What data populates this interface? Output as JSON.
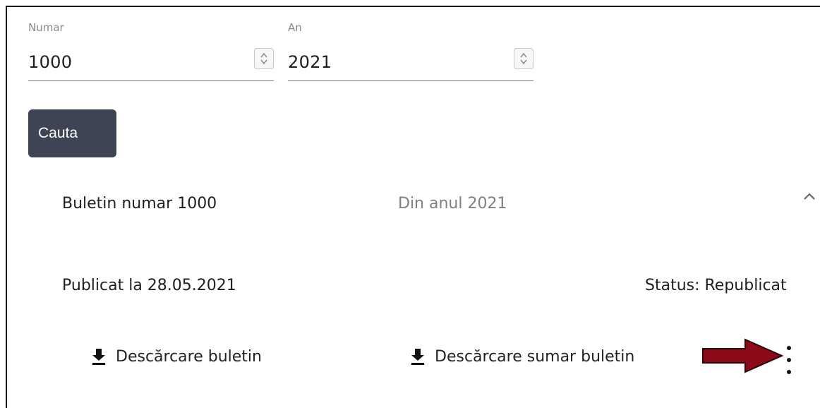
{
  "form": {
    "numar": {
      "label": "Numar",
      "value": "1000"
    },
    "an": {
      "label": "An",
      "value": "2021"
    },
    "search_label": "Cauta"
  },
  "result": {
    "title": "Buletin numar 1000",
    "year_text": "Din anul 2021",
    "published": "Publicat la 28.05.2021",
    "status": "Status: Republicat",
    "download_label": "Descărcare buletin",
    "download_summary_label": "Descărcare sumar buletin"
  },
  "icons": {
    "spinner": "up-down-chevron-icon",
    "collapse": "chevron-up-icon",
    "download": "download-icon",
    "more": "more-vert-icon",
    "annotation": "red-arrow-icon"
  },
  "colors": {
    "button_bg": "#3e4453",
    "annotation_arrow": "#8b0a1a",
    "muted_text": "#808080"
  }
}
